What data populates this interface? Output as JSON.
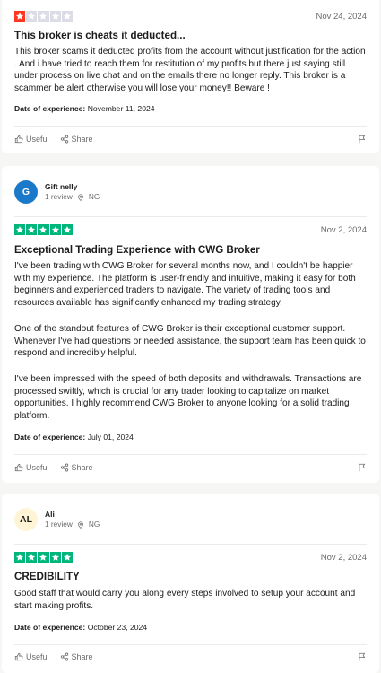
{
  "colors": {
    "star_red": "#ff3722",
    "star_green": "#00b67a",
    "star_empty": "#dcdce6"
  },
  "reviews": [
    {
      "rating": 1,
      "date": "Nov 24, 2024",
      "title": "This broker is cheats it deducted...",
      "body": "This broker scams it deducted profits from the account without justification for the action . And i have tried to reach them for restitution of my profits but there just saying still under process on live chat and on the emails there no longer reply. This broker is a scammer be alert otherwise you will lose your money!! Beware !",
      "doe_label": "Date of experience:",
      "doe_value": "November 11, 2024",
      "useful_label": "Useful",
      "share_label": "Share"
    },
    {
      "reviewer_initial": "G",
      "reviewer_name": "Gift nelly",
      "reviewer_reviews": "1 review",
      "reviewer_country": "NG",
      "rating": 5,
      "date": "Nov 2, 2024",
      "title": "Exceptional Trading Experience with CWG Broker",
      "body_p1": "I've been trading with CWG Broker for several months now, and I couldn't be happier with my experience. The platform is user-friendly and intuitive, making it easy for both beginners and experienced traders to navigate. The variety of trading tools and resources available has significantly enhanced my trading strategy.",
      "body_p2": "One of the standout features of CWG Broker is their exceptional customer support. Whenever I've had questions or needed assistance, the support team has been quick to respond and incredibly helpful.",
      "body_p3": "I've been impressed with the speed of both deposits and withdrawals. Transactions are processed swiftly, which is crucial for any trader looking to capitalize on market opportunities. I highly recommend CWG Broker to anyone looking for a solid trading platform.",
      "doe_label": "Date of experience:",
      "doe_value": "July 01, 2024",
      "useful_label": "Useful",
      "share_label": "Share"
    },
    {
      "reviewer_initial": "AL",
      "reviewer_name": "Ali",
      "reviewer_reviews": "1 review",
      "reviewer_country": "NG",
      "rating": 5,
      "date": "Nov 2, 2024",
      "title": "CREDIBILITY",
      "body": "Good staff that would carry you along every steps involved to setup your account and start making profits.",
      "doe_label": "Date of experience:",
      "doe_value": "October 23, 2024",
      "useful_label": "Useful",
      "share_label": "Share"
    }
  ]
}
